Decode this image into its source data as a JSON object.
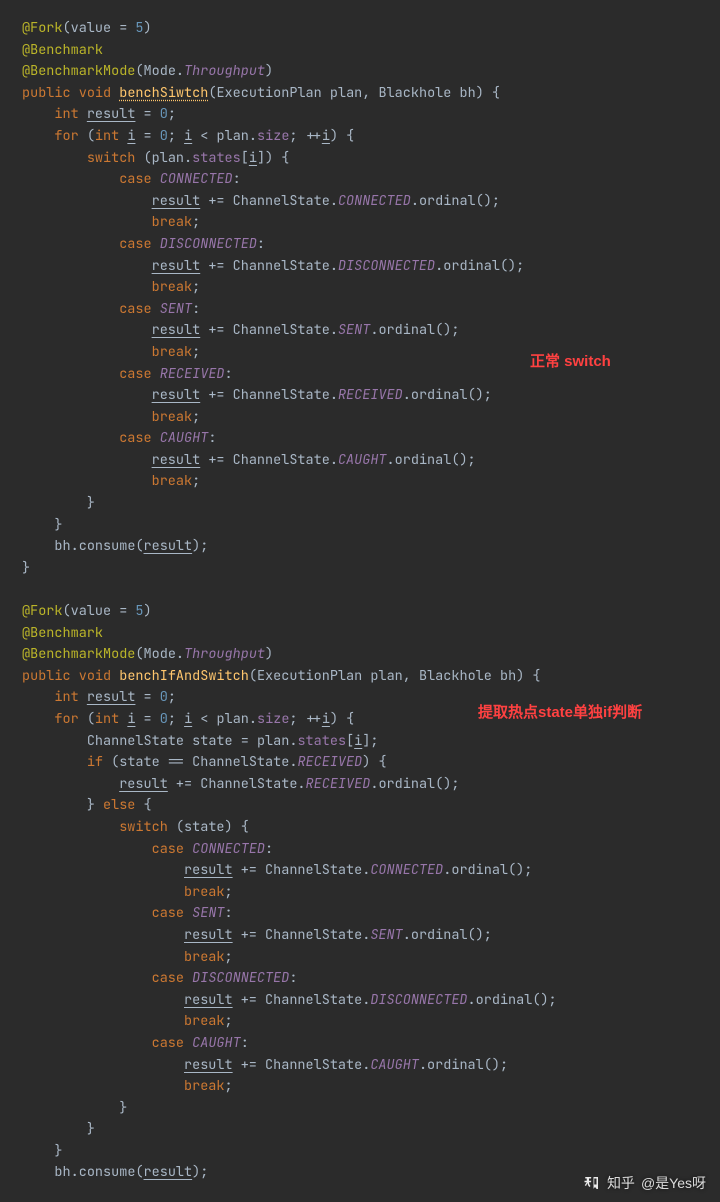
{
  "annotations": {
    "a1": "正常 switch",
    "a2": "提取热点state单独if判断"
  },
  "watermark": {
    "site": "知乎",
    "author": "@是Yes呀"
  },
  "code": {
    "fork_ann": "@Fork",
    "fork_param_name": "value",
    "fork_param_val": "5",
    "benchmark_ann": "@Benchmark",
    "benchmode_ann": "@BenchmarkMode",
    "benchmode_arg_cls": "Mode",
    "benchmode_arg_field": "Throughput",
    "method1": {
      "sig_kw_public": "public",
      "sig_kw_void": "void",
      "name": "benchSiwtch",
      "param1_type": "ExecutionPlan",
      "param1_name": "plan",
      "param2_type": "Blackhole",
      "param2_name": "bh",
      "int_kw": "int",
      "result": "result",
      "zero": "0",
      "for_kw": "for",
      "i": "i",
      "plan": "plan",
      "size": "size",
      "switch_kw": "switch",
      "states": "states",
      "case_kw": "case",
      "break_kw": "break",
      "channel_state": "ChannelState",
      "ordinal": "ordinal",
      "cases": [
        "CONNECTED",
        "DISCONNECTED",
        "SENT",
        "RECEIVED",
        "CAUGHT"
      ],
      "consume": "consume",
      "bh": "bh"
    },
    "method2": {
      "name": "benchIfAndSwitch",
      "state_type": "ChannelState",
      "state_var": "state",
      "if_kw": "if",
      "else_kw": "else",
      "received": "RECEIVED",
      "switch_cases": [
        "CONNECTED",
        "SENT",
        "DISCONNECTED",
        "CAUGHT"
      ]
    }
  }
}
